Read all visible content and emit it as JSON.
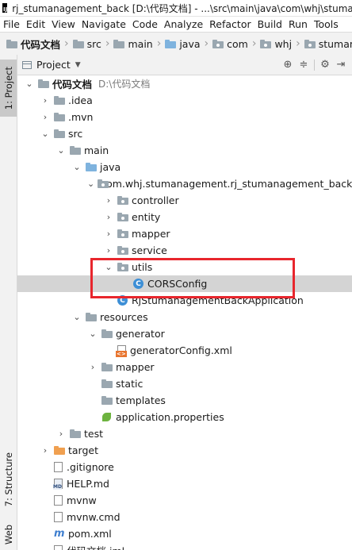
{
  "window": {
    "title": "rj_stumanagement_back [D:\\代码文档] - ...\\src\\main\\java\\com\\whj\\stumana",
    "app_icon_text": "IJ"
  },
  "menu": [
    "File",
    "Edit",
    "View",
    "Navigate",
    "Code",
    "Analyze",
    "Refactor",
    "Build",
    "Run",
    "Tools"
  ],
  "breadcrumbs": [
    "代码文档",
    "src",
    "main",
    "java",
    "com",
    "whj",
    "stumanage"
  ],
  "stripe": {
    "project_tab": "1: Project",
    "structure_tab": "7: Structure",
    "web_tab": "Web"
  },
  "panel": {
    "title": "Project"
  },
  "tree": [
    {
      "label": "代码文档",
      "hint": "D:\\代码文档",
      "depth": 0,
      "expanded": true,
      "icon": "folder"
    },
    {
      "label": ".idea",
      "depth": 1,
      "expanded": false,
      "icon": "folder"
    },
    {
      "label": ".mvn",
      "depth": 1,
      "expanded": false,
      "icon": "folder"
    },
    {
      "label": "src",
      "depth": 1,
      "expanded": true,
      "icon": "folder"
    },
    {
      "label": "main",
      "depth": 2,
      "expanded": true,
      "icon": "folder"
    },
    {
      "label": "java",
      "depth": 3,
      "expanded": true,
      "icon": "folder-blue"
    },
    {
      "label": "com.whj.stumanagement.rj_stumanagement_back",
      "depth": 4,
      "expanded": true,
      "icon": "package"
    },
    {
      "label": "controller",
      "depth": 5,
      "expanded": false,
      "icon": "package"
    },
    {
      "label": "entity",
      "depth": 5,
      "expanded": false,
      "icon": "package"
    },
    {
      "label": "mapper",
      "depth": 5,
      "expanded": false,
      "icon": "package"
    },
    {
      "label": "service",
      "depth": 5,
      "expanded": false,
      "icon": "package"
    },
    {
      "label": "utils",
      "depth": 5,
      "expanded": true,
      "icon": "package"
    },
    {
      "label": "CORSConfig",
      "depth": 6,
      "icon": "class",
      "selected": true
    },
    {
      "label": "RjStumanagementBackApplication",
      "depth": 5,
      "icon": "spring-class"
    },
    {
      "label": "resources",
      "depth": 3,
      "expanded": true,
      "icon": "folder-resources"
    },
    {
      "label": "generator",
      "depth": 4,
      "expanded": true,
      "icon": "folder"
    },
    {
      "label": "generatorConfig.xml",
      "depth": 5,
      "icon": "xml"
    },
    {
      "label": "mapper",
      "depth": 4,
      "expanded": false,
      "icon": "folder"
    },
    {
      "label": "static",
      "depth": 4,
      "icon": "folder"
    },
    {
      "label": "templates",
      "depth": 4,
      "icon": "folder"
    },
    {
      "label": "application.properties",
      "depth": 4,
      "icon": "spring-properties"
    },
    {
      "label": "test",
      "depth": 2,
      "expanded": false,
      "icon": "folder"
    },
    {
      "label": "target",
      "depth": 1,
      "expanded": false,
      "icon": "folder-orange"
    },
    {
      "label": ".gitignore",
      "depth": 1,
      "icon": "file"
    },
    {
      "label": "HELP.md",
      "depth": 1,
      "icon": "markdown"
    },
    {
      "label": "mvnw",
      "depth": 1,
      "icon": "file"
    },
    {
      "label": "mvnw.cmd",
      "depth": 1,
      "icon": "file"
    },
    {
      "label": "pom.xml",
      "depth": 1,
      "icon": "maven"
    },
    {
      "label": "代码文档.iml",
      "depth": 1,
      "icon": "file"
    }
  ]
}
